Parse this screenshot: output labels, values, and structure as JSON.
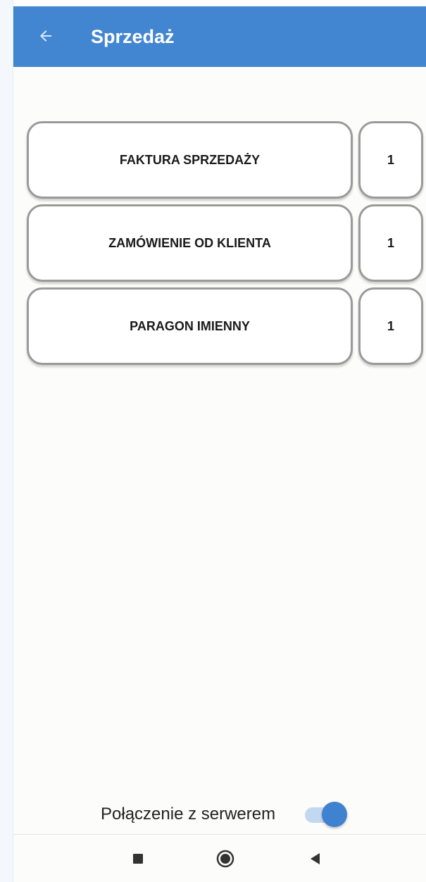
{
  "app_bar": {
    "title": "Sprzedaż",
    "background_color": "#4286d1",
    "back_icon": "arrow-left-icon"
  },
  "documents": [
    {
      "label": "FAKTURA SPRZEDAŻY",
      "count": "1"
    },
    {
      "label": "ZAMÓWIENIE OD KLIENTA",
      "count": "1"
    },
    {
      "label": "PARAGON IMIENNY",
      "count": "1"
    }
  ],
  "connection": {
    "label": "Połączenie z serwerem",
    "enabled": true
  },
  "nav_bar": {
    "icons": [
      "square-recents-icon",
      "circle-home-icon",
      "triangle-back-icon"
    ]
  }
}
